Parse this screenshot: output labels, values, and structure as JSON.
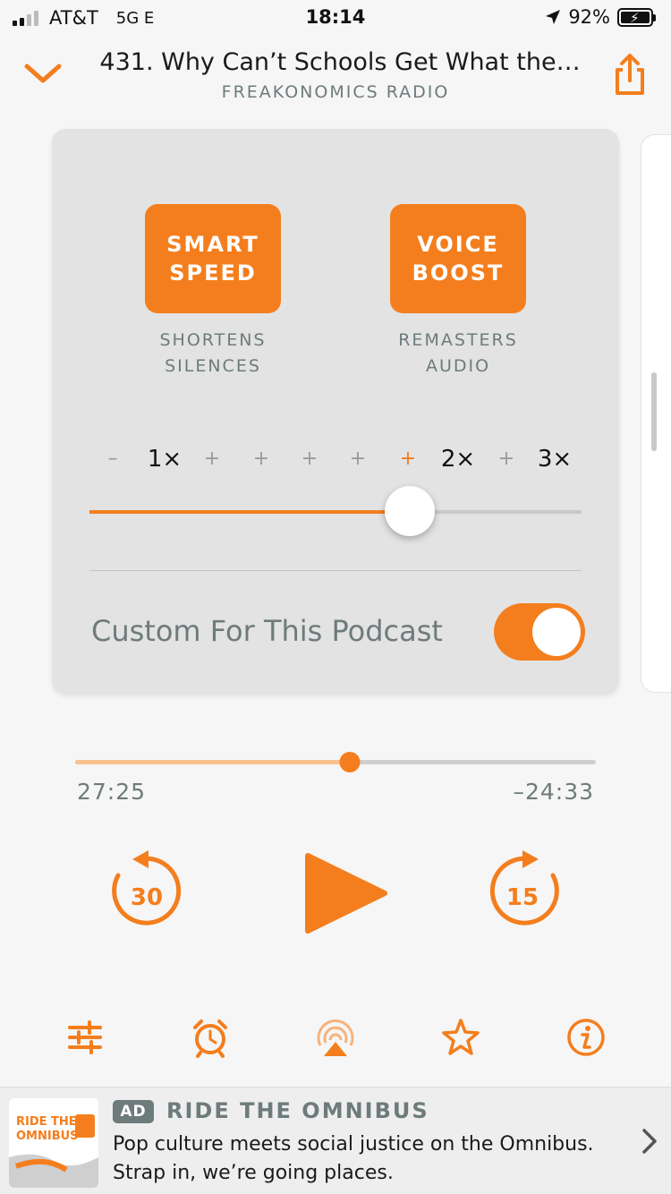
{
  "status_bar": {
    "carrier": "AT&T",
    "network": "5G E",
    "time": "18:14",
    "battery": "92%",
    "signal_bars": 2
  },
  "header": {
    "title": "431. Why Can’t Schools Get What the…",
    "subtitle": "FREAKONOMICS RADIO"
  },
  "effects": {
    "smart_speed": {
      "label": "SMART\nSPEED",
      "caption": "SHORTENS\nSILENCES"
    },
    "voice_boost": {
      "label": "VOICE\nBOOST",
      "caption": "REMASTERS\nAUDIO"
    }
  },
  "speed": {
    "ticks": [
      "–",
      "1×",
      "+",
      "+",
      "+",
      "+",
      "+",
      "2×",
      "+",
      "3×"
    ],
    "active_tick_index": 6,
    "slider_fraction": 0.65
  },
  "custom": {
    "label": "Custom For This Podcast",
    "enabled": true
  },
  "playback": {
    "progress_fraction": 0.527,
    "elapsed": "27:25",
    "remaining": "–24:33"
  },
  "transport": {
    "skip_back": "30",
    "skip_forward": "15"
  },
  "toolbar_icons": [
    "sliders-icon",
    "alarm-clock-icon",
    "airplay-icon",
    "star-icon",
    "info-icon"
  ],
  "ad": {
    "badge": "AD",
    "title": "RIDE THE OMNIBUS",
    "body": "Pop culture meets social justice on the Omnibus.\nStrap in, we’re going places.",
    "logo_text": "RIDE THE OMNIBUS"
  },
  "colors": {
    "accent": "#f47e1d",
    "muted": "#6e7b7b"
  }
}
